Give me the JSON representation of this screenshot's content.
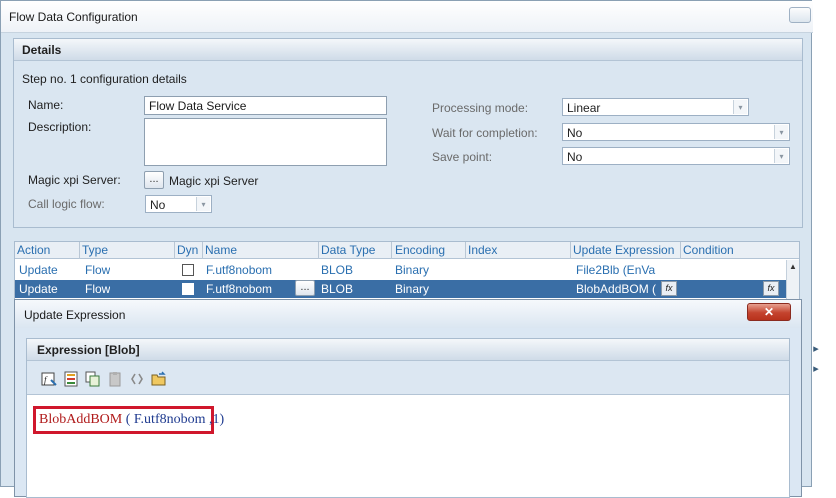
{
  "window": {
    "title": "Flow Data Configuration"
  },
  "details": {
    "header": "Details",
    "step_caption": "Step no. 1 configuration details",
    "name_label": "Name:",
    "name_value": "Flow Data Service",
    "description_label": "Description:",
    "description_value": "",
    "server_label": "Magic xpi Server:",
    "server_button": "...",
    "server_value": "Magic xpi Server",
    "call_logic_label": "Call logic flow:",
    "call_logic_value": "No",
    "processing_label": "Processing mode:",
    "processing_value": "Linear",
    "wait_label": "Wait for completion:",
    "wait_value": "No",
    "savepoint_label": "Save point:",
    "savepoint_value": "No"
  },
  "grid": {
    "columns": [
      "Action",
      "Type",
      "Dyn",
      "Name",
      "Data Type",
      "Encoding",
      "Index",
      "Update Expression",
      "Condition"
    ],
    "rows": [
      {
        "action": "Update",
        "type": "Flow",
        "name": "F.utf8nobom",
        "data_type": "BLOB",
        "encoding": "Binary",
        "index": "",
        "update_expression": "File2Blb (EnVa",
        "condition": ""
      },
      {
        "action": "Update",
        "type": "Flow",
        "name": "F.utf8nobom",
        "data_type": "BLOB",
        "encoding": "Binary",
        "index": "",
        "update_expression": "BlobAddBOM (",
        "condition": ""
      }
    ],
    "ellipsis_label": "...",
    "fx_label": "fx"
  },
  "dialog": {
    "title": "Update Expression",
    "close_label": "✕",
    "section_header": "Expression [Blob]",
    "expression_function": "BlobAddBOM",
    "expression_args": " ( F.utf8nobom ,1)"
  },
  "icons": {
    "combo_arrow": "▾",
    "scroll_up": "▲"
  },
  "colors": {
    "selected_row": "#3a6ea5",
    "highlight_box": "#d0172c",
    "link_text": "#2a6fb0"
  }
}
